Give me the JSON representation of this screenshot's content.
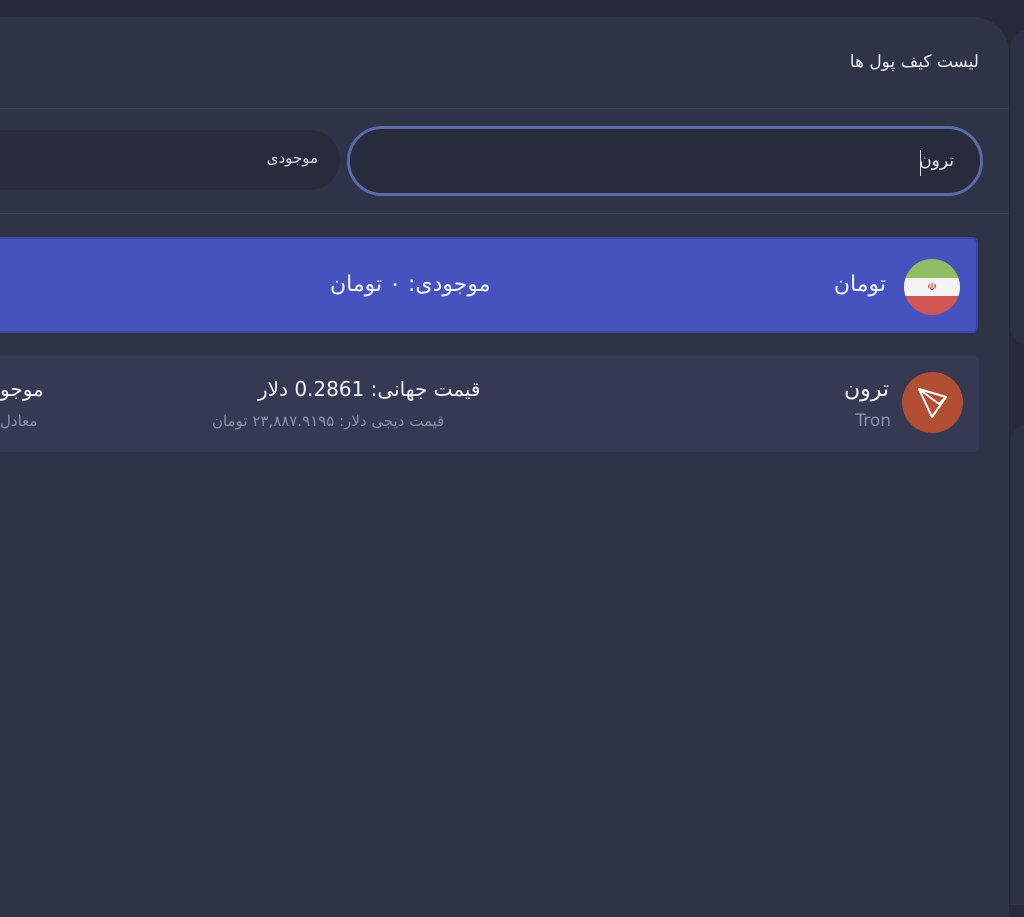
{
  "header": {
    "title": "لیست کیف پول ها"
  },
  "search": {
    "value": "ترون"
  },
  "filter": {
    "label": "موجودی"
  },
  "wallets": [
    {
      "name": "تومان",
      "icon": "iran-flag-icon",
      "balance": "موجودی: ۰ تومان",
      "selected": true
    },
    {
      "name": "ترون",
      "symbol": "Tron",
      "icon": "tron-icon",
      "global_price": "قیمت جهانی: 0.2861 دلار",
      "digi_price": "قیمت دیجی دلار: ۲۳,۸۸۷.۹۱۹۵ تومان",
      "balance_cut": "موجو",
      "equiv_cut": "معادل"
    }
  ],
  "colors": {
    "background": "#262a3a",
    "panel": "#2f3347",
    "selected_row": "#4653be",
    "row": "#353a52",
    "search_border": "#5a6baa",
    "tron": "#b24e34"
  }
}
